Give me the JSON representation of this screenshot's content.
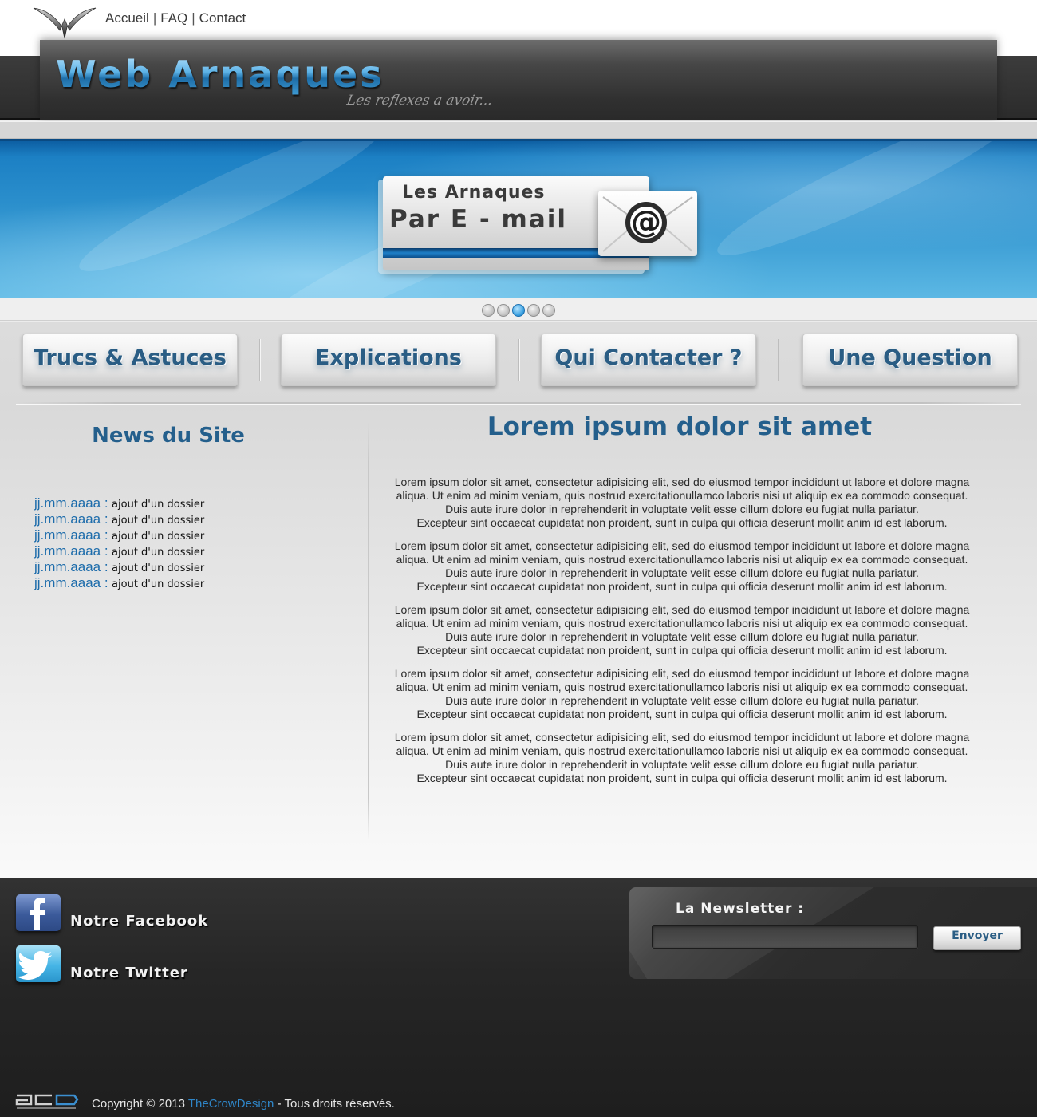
{
  "topnav": {
    "home": "Accueil",
    "faq": "FAQ",
    "contact": "Contact",
    "separator": "|"
  },
  "header": {
    "title": "Web Arnaques",
    "slogan": "Les reflexes a avoir..."
  },
  "slider": {
    "line1": "Les Arnaques",
    "line2": "Par  E - mail",
    "mail_icon": "at-envelope-icon",
    "dots_count": 5,
    "active_dot": 3
  },
  "menu": {
    "items": [
      {
        "label": "Trucs & Astuces"
      },
      {
        "label": "Explications"
      },
      {
        "label": "Qui Contacter ?"
      },
      {
        "label": "Une Question"
      }
    ]
  },
  "news": {
    "title": "News du Site",
    "items": [
      {
        "date": "jj.mm.aaaa :",
        "text": "ajout d'un dossier"
      },
      {
        "date": "jj.mm.aaaa :",
        "text": "ajout d'un dossier"
      },
      {
        "date": "jj.mm.aaaa :",
        "text": "ajout d'un dossier"
      },
      {
        "date": "jj.mm.aaaa :",
        "text": "ajout d'un dossier"
      },
      {
        "date": "jj.mm.aaaa :",
        "text": "ajout d'un dossier"
      },
      {
        "date": "jj.mm.aaaa :",
        "text": "ajout d'un dossier"
      }
    ]
  },
  "main": {
    "title": "Lorem ipsum dolor sit amet",
    "paragraphs": [
      {
        "l1": "Lorem ipsum dolor sit amet, consectetur adipisicing elit, sed do eiusmod tempor incididunt ut labore et dolore magna",
        "l2": "aliqua. Ut enim ad minim veniam, quis nostrud exercitationullamco laboris nisi ut aliquip ex ea commodo consequat.",
        "l3": "Duis aute irure dolor in reprehenderit in voluptate velit esse cillum dolore eu fugiat nulla pariatur.",
        "l4": "Excepteur sint occaecat cupidatat non proident, sunt in culpa qui officia deserunt mollit anim id est laborum."
      },
      {
        "l1": "Lorem ipsum dolor sit amet, consectetur adipisicing elit, sed do eiusmod tempor incididunt ut labore et dolore magna",
        "l2": "aliqua. Ut enim ad minim veniam, quis nostrud exercitationullamco laboris nisi ut aliquip ex ea commodo consequat.",
        "l3": "Duis aute irure dolor in reprehenderit in voluptate velit esse cillum dolore eu fugiat nulla pariatur.",
        "l4": "Excepteur sint occaecat cupidatat non proident, sunt in culpa qui officia deserunt mollit anim id est laborum."
      },
      {
        "l1": "Lorem ipsum dolor sit amet, consectetur adipisicing elit, sed do eiusmod tempor incididunt ut labore et dolore magna",
        "l2": "aliqua. Ut enim ad minim veniam, quis nostrud exercitationullamco laboris nisi ut aliquip ex ea commodo consequat.",
        "l3": "Duis aute irure dolor in reprehenderit in voluptate velit esse cillum dolore eu fugiat nulla pariatur.",
        "l4": "Excepteur sint occaecat cupidatat non proident, sunt in culpa qui officia deserunt mollit anim id est laborum."
      },
      {
        "l1": "Lorem ipsum dolor sit amet, consectetur adipisicing elit, sed do eiusmod tempor incididunt ut labore et dolore magna",
        "l2": "aliqua. Ut enim ad minim veniam, quis nostrud exercitationullamco laboris nisi ut aliquip ex ea commodo consequat.",
        "l3": "Duis aute irure dolor in reprehenderit in voluptate velit esse cillum dolore eu fugiat nulla pariatur.",
        "l4": "Excepteur sint occaecat cupidatat non proident, sunt in culpa qui officia deserunt mollit anim id est laborum."
      },
      {
        "l1": "Lorem ipsum dolor sit amet, consectetur adipisicing elit, sed do eiusmod tempor incididunt ut labore et dolore magna",
        "l2": "aliqua. Ut enim ad minim veniam, quis nostrud exercitationullamco laboris nisi ut aliquip ex ea commodo consequat.",
        "l3": "Duis aute irure dolor in reprehenderit in voluptate velit esse cillum dolore eu fugiat nulla pariatur.",
        "l4": "Excepteur sint occaecat cupidatat non proident, sunt in culpa qui officia deserunt mollit anim id est laborum."
      }
    ]
  },
  "footer": {
    "facebook_label": "Notre Facebook",
    "twitter_label": "Notre Twitter",
    "facebook_icon": "facebook-icon",
    "twitter_icon": "twitter-icon",
    "newsletter_title": "La Newsletter :",
    "newsletter_value": "",
    "newsletter_button": "Envoyer",
    "copyright_prefix": "Copyright © 2013",
    "copyright_brand": "TheCrowDesign",
    "copyright_suffix": "- Tous droits réservés."
  },
  "colors": {
    "accent_blue": "#245f8c",
    "link_blue": "#1d6cab",
    "footer_bg": "#262626"
  }
}
